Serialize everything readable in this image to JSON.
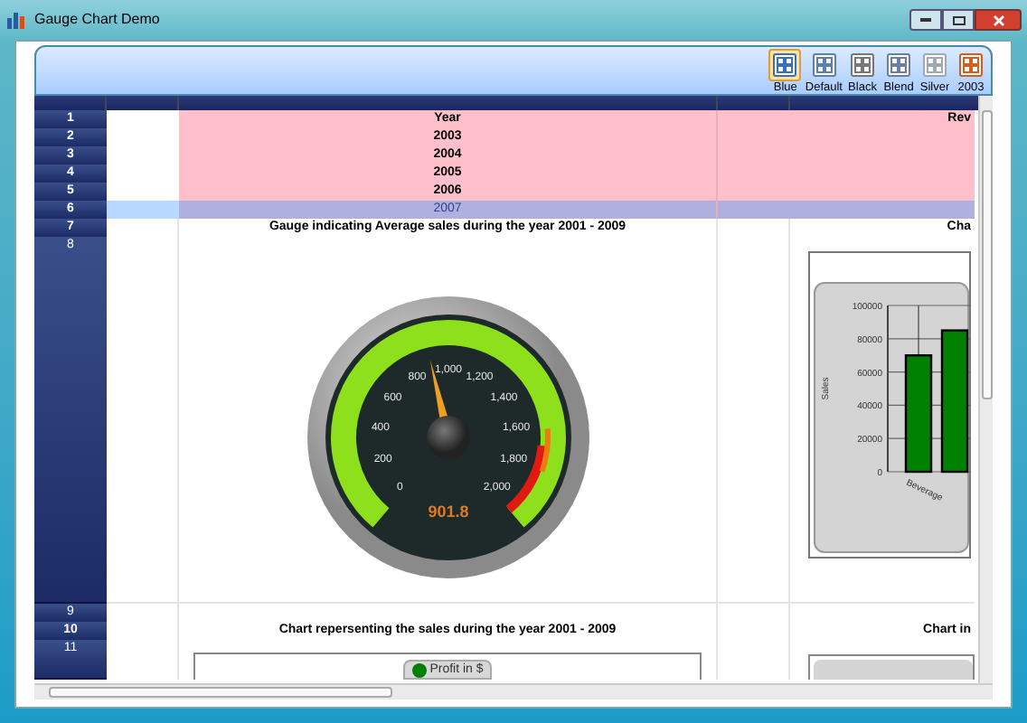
{
  "window": {
    "title": "Gauge Chart Demo"
  },
  "themes": [
    {
      "label": "Blue",
      "selected": true
    },
    {
      "label": "Default",
      "selected": false
    },
    {
      "label": "Black",
      "selected": false
    },
    {
      "label": "Blend",
      "selected": false
    },
    {
      "label": "Silver",
      "selected": false
    },
    {
      "label": "2003",
      "selected": false
    }
  ],
  "grid": {
    "rows": [
      {
        "number": "1",
        "kind": "data",
        "selected": false,
        "year": "Year",
        "revenue": "Rev"
      },
      {
        "number": "2",
        "kind": "data",
        "selected": false,
        "year": "2003"
      },
      {
        "number": "3",
        "kind": "data",
        "selected": false,
        "year": "2004"
      },
      {
        "number": "4",
        "kind": "data",
        "selected": false,
        "year": "2005"
      },
      {
        "number": "5",
        "kind": "data",
        "selected": false,
        "year": "2006"
      },
      {
        "number": "6",
        "kind": "data",
        "selected": true,
        "year": "2007"
      },
      {
        "number": "7",
        "kind": "caption",
        "caption": "Gauge indicating Average sales during the year 2001 - 2009",
        "caption_right": "Cha"
      },
      {
        "number": "8",
        "kind": "charts"
      },
      {
        "number": "9",
        "kind": "blank"
      },
      {
        "number": "10",
        "kind": "caption",
        "caption": "Chart repersenting the sales during the year 2001 - 2009",
        "caption_right": "Chart in"
      },
      {
        "number": "11",
        "kind": "legend",
        "legend": "Profit in $",
        "color": "#008000"
      }
    ]
  },
  "gauge": {
    "tick_labels": [
      "0",
      "200",
      "400",
      "600",
      "800",
      "1,000",
      "1,200",
      "1,400",
      "1,600",
      "1,800",
      "2,000"
    ],
    "value": "901.8",
    "level": 0.4509
  },
  "bar_chart": {
    "chart_data": {
      "type": "bar",
      "ylabel": "Sales",
      "categories": [
        "Beverage",
        null
      ],
      "series": [
        {
          "color": "#008000",
          "values": [
            70000,
            85000
          ]
        }
      ],
      "grid": true,
      "ylim": [
        0,
        100000
      ],
      "yticks": [
        0,
        20000,
        40000,
        60000,
        80000,
        100000
      ]
    }
  }
}
